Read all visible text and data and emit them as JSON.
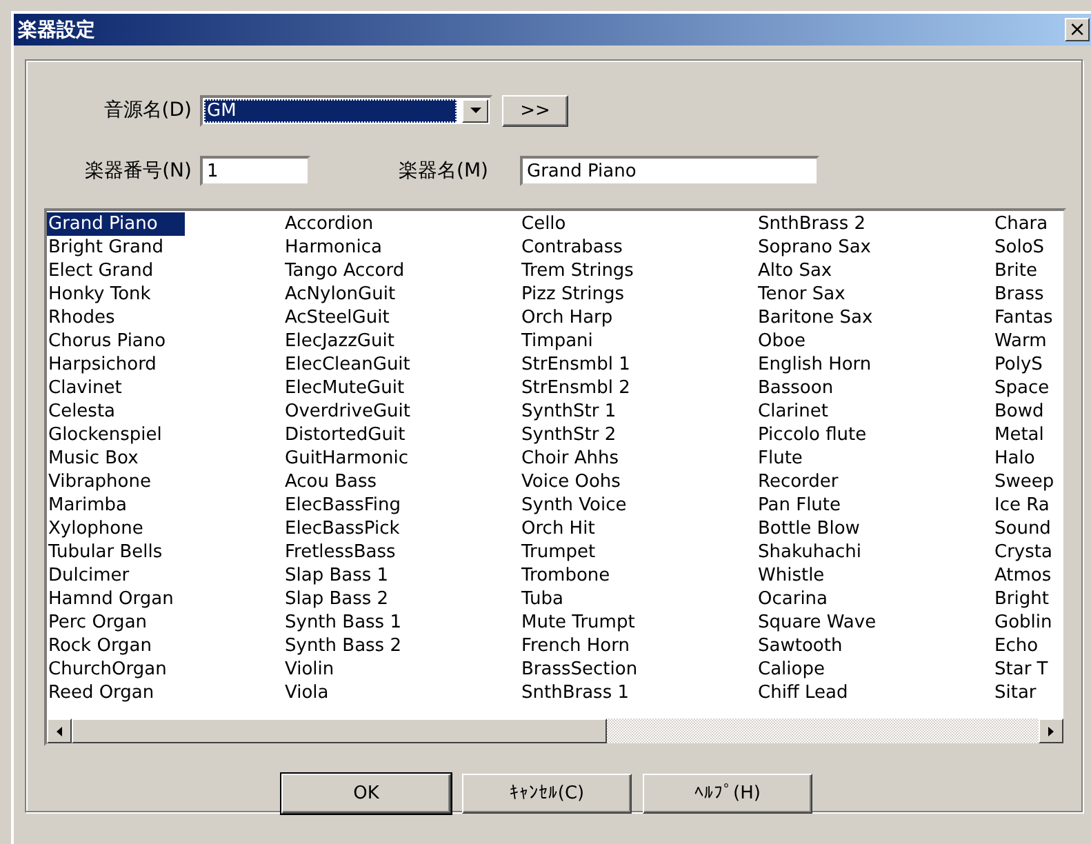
{
  "window": {
    "title": "楽器設定",
    "close": "×"
  },
  "source": {
    "label": "音源名(D)",
    "value": "GM",
    "more": ">>"
  },
  "number": {
    "label": "楽器番号(N)",
    "value": "1"
  },
  "name": {
    "label": "楽器名(M)",
    "value": "Grand Piano"
  },
  "instrument_columns": [
    [
      {
        "name": "Grand Piano",
        "selected": true
      },
      {
        "name": "Bright Grand",
        "selected": false
      },
      {
        "name": "Elect Grand",
        "selected": false
      },
      {
        "name": "Honky Tonk",
        "selected": false
      },
      {
        "name": "Rhodes",
        "selected": false
      },
      {
        "name": "Chorus Piano",
        "selected": false
      },
      {
        "name": "Harpsichord",
        "selected": false
      },
      {
        "name": "Clavinet",
        "selected": false
      },
      {
        "name": "Celesta",
        "selected": false
      },
      {
        "name": "Glockenspiel",
        "selected": false
      },
      {
        "name": "Music Box",
        "selected": false
      },
      {
        "name": "Vibraphone",
        "selected": false
      },
      {
        "name": "Marimba",
        "selected": false
      },
      {
        "name": "Xylophone",
        "selected": false
      },
      {
        "name": "Tubular Bells",
        "selected": false
      },
      {
        "name": "Dulcimer",
        "selected": false
      },
      {
        "name": "Hamnd Organ",
        "selected": false
      },
      {
        "name": "Perc Organ",
        "selected": false
      },
      {
        "name": "Rock Organ",
        "selected": false
      },
      {
        "name": "ChurchOrgan",
        "selected": false
      },
      {
        "name": "Reed Organ",
        "selected": false
      }
    ],
    [
      {
        "name": "Accordion",
        "selected": false
      },
      {
        "name": "Harmonica",
        "selected": false
      },
      {
        "name": "Tango Accord",
        "selected": false
      },
      {
        "name": "AcNylonGuit",
        "selected": false
      },
      {
        "name": "AcSteelGuit",
        "selected": false
      },
      {
        "name": "ElecJazzGuit",
        "selected": false
      },
      {
        "name": "ElecCleanGuit",
        "selected": false
      },
      {
        "name": "ElecMuteGuit",
        "selected": false
      },
      {
        "name": "OverdriveGuit",
        "selected": false
      },
      {
        "name": "DistortedGuit",
        "selected": false
      },
      {
        "name": "GuitHarmonic",
        "selected": false
      },
      {
        "name": "Acou Bass",
        "selected": false
      },
      {
        "name": "ElecBassFing",
        "selected": false
      },
      {
        "name": "ElecBassPick",
        "selected": false
      },
      {
        "name": "FretlessBass",
        "selected": false
      },
      {
        "name": "Slap Bass 1",
        "selected": false
      },
      {
        "name": "Slap Bass 2",
        "selected": false
      },
      {
        "name": "Synth Bass 1",
        "selected": false
      },
      {
        "name": "Synth Bass 2",
        "selected": false
      },
      {
        "name": "Violin",
        "selected": false
      },
      {
        "name": "Viola",
        "selected": false
      }
    ],
    [
      {
        "name": "Cello",
        "selected": false
      },
      {
        "name": "Contrabass",
        "selected": false
      },
      {
        "name": "Trem Strings",
        "selected": false
      },
      {
        "name": "Pizz Strings",
        "selected": false
      },
      {
        "name": "Orch Harp",
        "selected": false
      },
      {
        "name": "Timpani",
        "selected": false
      },
      {
        "name": "StrEnsmbl 1",
        "selected": false
      },
      {
        "name": "StrEnsmbl 2",
        "selected": false
      },
      {
        "name": "SynthStr 1",
        "selected": false
      },
      {
        "name": "SynthStr 2",
        "selected": false
      },
      {
        "name": "Choir Ahhs",
        "selected": false
      },
      {
        "name": "Voice Oohs",
        "selected": false
      },
      {
        "name": "Synth Voice",
        "selected": false
      },
      {
        "name": "Orch Hit",
        "selected": false
      },
      {
        "name": "Trumpet",
        "selected": false
      },
      {
        "name": "Trombone",
        "selected": false
      },
      {
        "name": "Tuba",
        "selected": false
      },
      {
        "name": "Mute Trumpt",
        "selected": false
      },
      {
        "name": "French Horn",
        "selected": false
      },
      {
        "name": "BrassSection",
        "selected": false
      },
      {
        "name": "SnthBrass 1",
        "selected": false
      }
    ],
    [
      {
        "name": "SnthBrass 2",
        "selected": false
      },
      {
        "name": "Soprano Sax",
        "selected": false
      },
      {
        "name": "Alto Sax",
        "selected": false
      },
      {
        "name": "Tenor Sax",
        "selected": false
      },
      {
        "name": "Baritone Sax",
        "selected": false
      },
      {
        "name": "Oboe",
        "selected": false
      },
      {
        "name": "English Horn",
        "selected": false
      },
      {
        "name": "Bassoon",
        "selected": false
      },
      {
        "name": "Clarinet",
        "selected": false
      },
      {
        "name": "Piccolo flute",
        "selected": false
      },
      {
        "name": "Flute",
        "selected": false
      },
      {
        "name": "Recorder",
        "selected": false
      },
      {
        "name": "Pan Flute",
        "selected": false
      },
      {
        "name": "Bottle Blow",
        "selected": false
      },
      {
        "name": "Shakuhachi",
        "selected": false
      },
      {
        "name": "Whistle",
        "selected": false
      },
      {
        "name": "Ocarina",
        "selected": false
      },
      {
        "name": "Square Wave",
        "selected": false
      },
      {
        "name": "Sawtooth",
        "selected": false
      },
      {
        "name": "Caliope",
        "selected": false
      },
      {
        "name": "Chiff Lead",
        "selected": false
      }
    ],
    [
      {
        "name": "Chara",
        "selected": false
      },
      {
        "name": "SoloS",
        "selected": false
      },
      {
        "name": "Brite",
        "selected": false
      },
      {
        "name": "Brass",
        "selected": false
      },
      {
        "name": "Fantas",
        "selected": false
      },
      {
        "name": "Warm",
        "selected": false
      },
      {
        "name": "PolyS",
        "selected": false
      },
      {
        "name": "Space",
        "selected": false
      },
      {
        "name": "Bowd",
        "selected": false
      },
      {
        "name": "Metal",
        "selected": false
      },
      {
        "name": "Halo",
        "selected": false
      },
      {
        "name": "Sweep",
        "selected": false
      },
      {
        "name": "Ice Ra",
        "selected": false
      },
      {
        "name": "Sound",
        "selected": false
      },
      {
        "name": "Crysta",
        "selected": false
      },
      {
        "name": "Atmos",
        "selected": false
      },
      {
        "name": "Bright",
        "selected": false
      },
      {
        "name": "Goblin",
        "selected": false
      },
      {
        "name": "Echo",
        "selected": false
      },
      {
        "name": "Star T",
        "selected": false
      },
      {
        "name": "Sitar",
        "selected": false
      }
    ]
  ],
  "buttons": [
    {
      "label": "OK",
      "default": true
    },
    {
      "label": "ｷｬﾝｾﾙ(C)",
      "default": false
    },
    {
      "label": "ﾍﾙﾌﾟ(H)",
      "default": false
    }
  ]
}
